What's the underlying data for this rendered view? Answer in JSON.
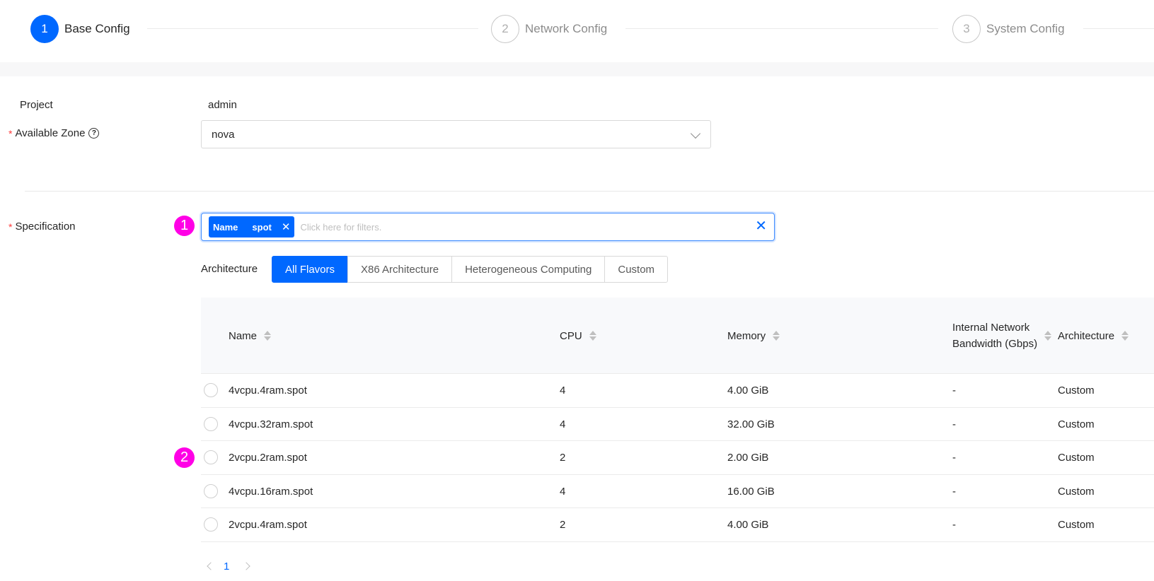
{
  "steps": [
    {
      "number": "1",
      "label": "Base Config",
      "state": "active"
    },
    {
      "number": "2",
      "label": "Network Config",
      "state": "wait"
    },
    {
      "number": "3",
      "label": "System Config",
      "state": "wait"
    }
  ],
  "form": {
    "project_label": "Project",
    "project_value": "admin",
    "zone_label": "Available Zone",
    "zone_required": "*",
    "zone_help_icon": "?",
    "zone_value": "nova",
    "spec_label": "Specification",
    "spec_required": "*"
  },
  "markers": {
    "m1": "1",
    "m2": "2"
  },
  "filter": {
    "tag_key": "Name",
    "tag_value": "spot",
    "tag_close": "✕",
    "placeholder": "Click here for filters.",
    "clear_icon": "✕"
  },
  "architecture": {
    "label": "Architecture",
    "options": [
      "All Flavors",
      "X86 Architecture",
      "Heterogeneous Computing",
      "Custom"
    ],
    "selected": "All Flavors"
  },
  "table": {
    "columns": {
      "name": "Name",
      "cpu": "CPU",
      "memory": "Memory",
      "bandwidth": "Internal Network Bandwidth (Gbps)",
      "architecture": "Architecture"
    },
    "rows": [
      {
        "name": "4vcpu.4ram.spot",
        "cpu": "4",
        "memory": "4.00 GiB",
        "bandwidth": "-",
        "architecture": "Custom"
      },
      {
        "name": "4vcpu.32ram.spot",
        "cpu": "4",
        "memory": "32.00 GiB",
        "bandwidth": "-",
        "architecture": "Custom"
      },
      {
        "name": "2vcpu.2ram.spot",
        "cpu": "2",
        "memory": "2.00 GiB",
        "bandwidth": "-",
        "architecture": "Custom"
      },
      {
        "name": "4vcpu.16ram.spot",
        "cpu": "4",
        "memory": "16.00 GiB",
        "bandwidth": "-",
        "architecture": "Custom"
      },
      {
        "name": "2vcpu.4ram.spot",
        "cpu": "2",
        "memory": "4.00 GiB",
        "bandwidth": "-",
        "architecture": "Custom"
      }
    ]
  },
  "pagination": {
    "current": "1"
  },
  "colors": {
    "accent": "#0068ff",
    "marker": "#ff00e6",
    "required": "#ff3b3b"
  }
}
